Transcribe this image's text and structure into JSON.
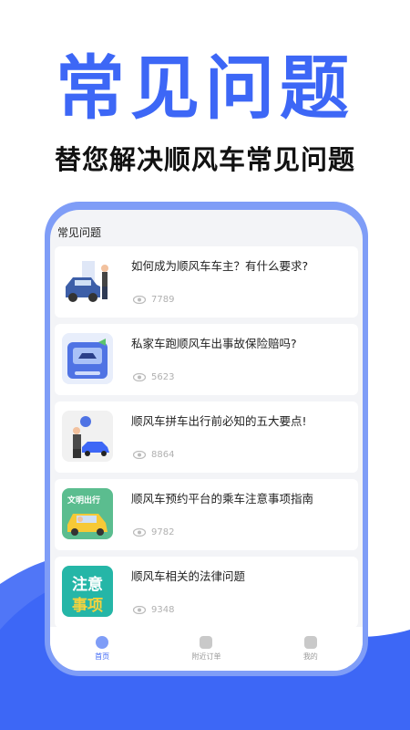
{
  "promo": {
    "headline": "常见问题",
    "subline": "替您解决顺风车常见问题"
  },
  "screen": {
    "title": "常见问题",
    "items": [
      {
        "title": "如何成为顺风车车主？有什么要求?",
        "views": "7789",
        "thumb": "car-owner-illustration"
      },
      {
        "title": "私家车跑顺风车出事故保险赔吗?",
        "views": "5623",
        "thumb": "car-insurance-illustration"
      },
      {
        "title": "顺风车拼车出行前必知的五大要点!",
        "views": "8864",
        "thumb": "carpool-tips-illustration"
      },
      {
        "title": "顺风车预约平台的乘车注意事项指南",
        "views": "9782",
        "thumb": "civilized-travel-illustration",
        "thumb_text": "文明出行"
      },
      {
        "title": "顺风车相关的法律问题",
        "views": "9348",
        "thumb": "notice-illustration",
        "thumb_text_1": "注意",
        "thumb_text_2": "事项"
      }
    ],
    "tabs": [
      {
        "label": "首页",
        "icon": "home-icon",
        "active": true
      },
      {
        "label": "附近订单",
        "icon": "orders-icon",
        "active": false
      },
      {
        "label": "我的",
        "icon": "profile-icon",
        "active": false
      }
    ]
  },
  "colors": {
    "brand": "#3d67f6",
    "phone_frame": "#7f9df7",
    "screen_bg": "#f3f4f7"
  }
}
